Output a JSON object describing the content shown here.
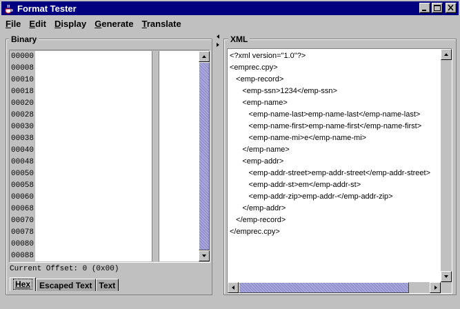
{
  "window": {
    "title": "Format Tester"
  },
  "menu": {
    "items": [
      {
        "label": "File",
        "mnemonic": "F",
        "rest": "ile"
      },
      {
        "label": "Edit",
        "mnemonic": "E",
        "rest": "dit"
      },
      {
        "label": "Display",
        "mnemonic": "D",
        "rest": "isplay"
      },
      {
        "label": "Generate",
        "mnemonic": "G",
        "rest": "enerate"
      },
      {
        "label": "Translate",
        "mnemonic": "T",
        "rest": "ranslate"
      }
    ]
  },
  "binary": {
    "title": "Binary",
    "offsets": [
      "00000",
      "00008",
      "00010",
      "00018",
      "00020",
      "00028",
      "00030",
      "00038",
      "00040",
      "00048",
      "00050",
      "00058",
      "00060",
      "00068",
      "00070",
      "00078",
      "00080",
      "00088"
    ],
    "current_offset": "Current Offset: 0 (0x00)",
    "tabs": [
      {
        "label": "Hex",
        "active": true
      },
      {
        "label": "Escaped Text",
        "active": false
      },
      {
        "label": "Text",
        "active": false
      }
    ]
  },
  "xml": {
    "title": "XML",
    "lines": [
      "<?xml version=\"1.0\"?>",
      "<emprec.cpy>",
      "   <emp-record>",
      "      <emp-ssn>1234</emp-ssn>",
      "      <emp-name>",
      "         <emp-name-last>emp-name-last</emp-name-last>",
      "         <emp-name-first>emp-name-first</emp-name-first>",
      "         <emp-name-mi>e</emp-name-mi>",
      "      </emp-name>",
      "      <emp-addr>",
      "         <emp-addr-street>emp-addr-street</emp-addr-street>",
      "         <emp-addr-st>em</emp-addr-st>",
      "         <emp-addr-zip>emp-addr-</emp-addr-zip>",
      "      </emp-addr>",
      "   </emp-record>",
      "</emprec.cpy>"
    ]
  },
  "icons": {
    "app": "java-cup-icon",
    "minimize": "minimize-icon",
    "maximize": "maximize-icon",
    "close": "close-icon"
  },
  "colors": {
    "titlebar": "#000080",
    "scroll_thumb": "#9a9acf",
    "face": "#c0c0c0"
  }
}
